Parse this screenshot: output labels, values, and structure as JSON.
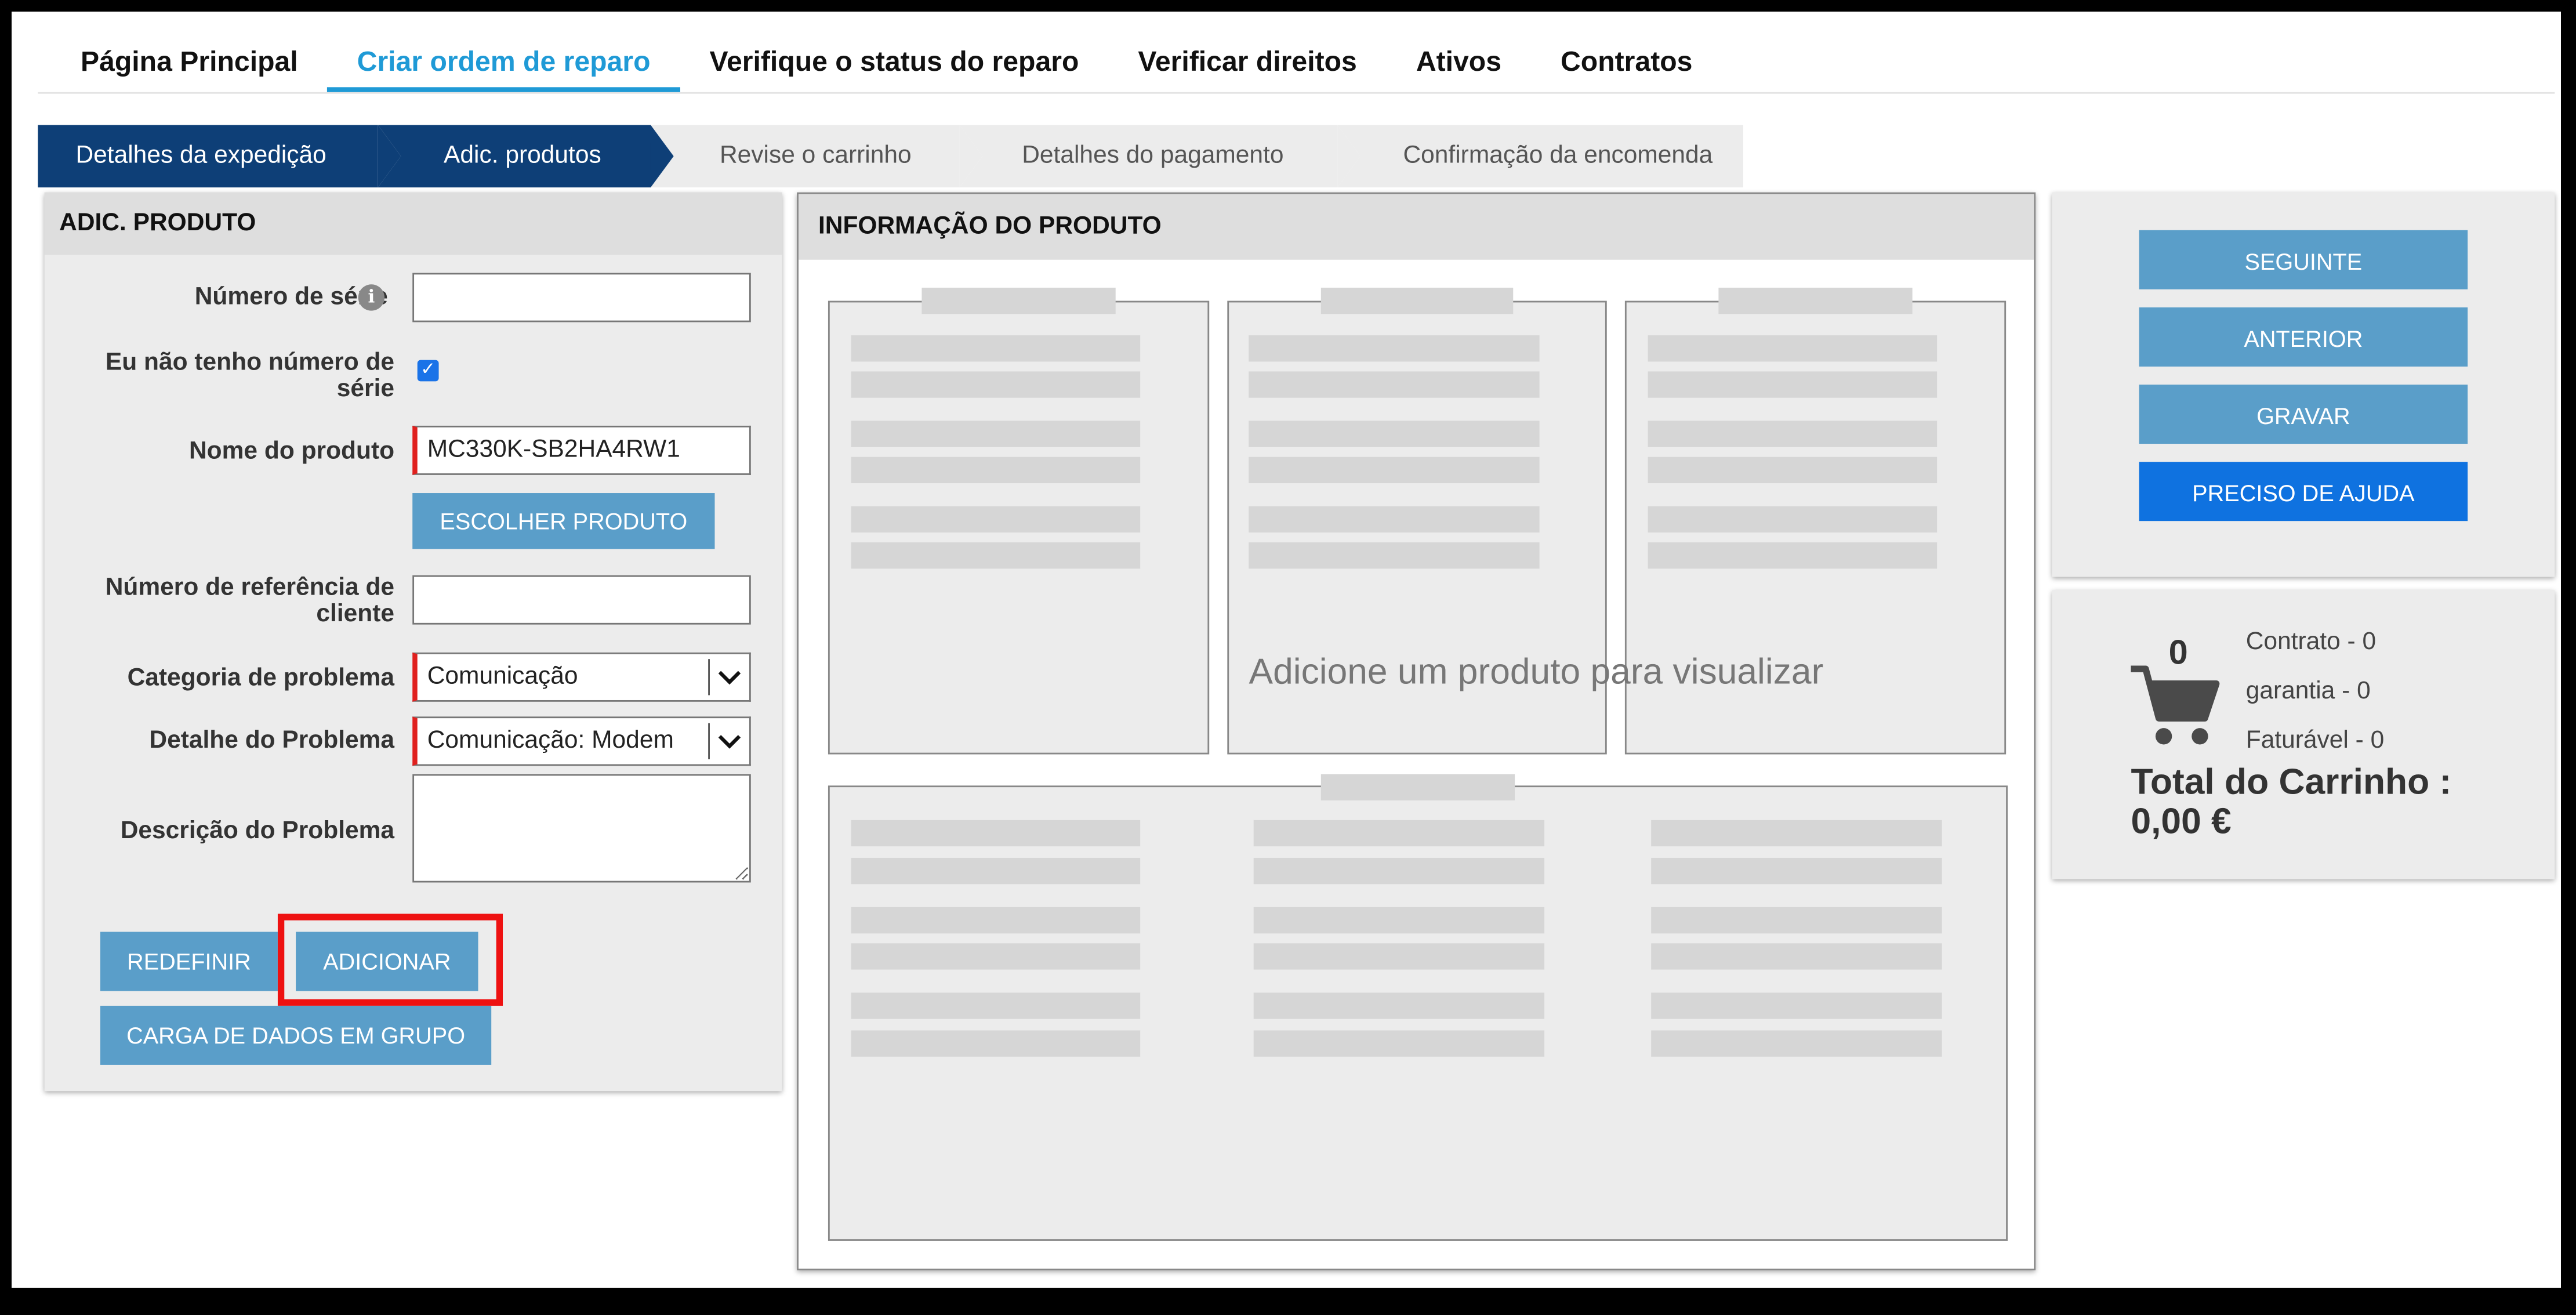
{
  "top_nav": [
    "Página Principal",
    "Criar ordem de reparo",
    "Verifique o status do reparo",
    "Verificar direitos",
    "Ativos",
    "Contratos"
  ],
  "steps": [
    "Detalhes da expedição",
    "Adic. produtos",
    "Revise o carrinho",
    "Detalhes do pagamento",
    "Confirmação da encomenda"
  ],
  "add_product": {
    "title": "ADIC. PRODUTO",
    "serial_label": "Número de série",
    "serial_value": "",
    "no_serial_label": "Eu não tenho número de série",
    "no_serial_checked": true,
    "product_name_label": "Nome do produto",
    "product_name_value": "MC330K-SB2HA4RW1",
    "choose_product_button": "ESCOLHER PRODUTO",
    "customer_ref_label": "Número de referência de cliente",
    "customer_ref_value": "",
    "problem_category_label": "Categoria de problema",
    "problem_category_value": "Comunicação",
    "problem_detail_label": "Detalhe do Problema",
    "problem_detail_value": "Comunicação: Modem",
    "problem_description_label": "Descrição do Problema",
    "problem_description_value": "",
    "reset_button": "REDEFINIR",
    "add_button": "ADICIONAR",
    "bulk_upload_button": "CARGA DE DADOS EM GRUPO"
  },
  "product_info": {
    "title": "INFORMAÇÃO DO PRODUTO",
    "placeholder": "Adicione um produto para visualizar"
  },
  "actions": {
    "next": "SEGUINTE",
    "previous": "ANTERIOR",
    "save": "GRAVAR",
    "help": "PRECISO DE AJUDA"
  },
  "cart": {
    "icon": "shopping-cart-icon",
    "count": "0",
    "contract": "Contrato - 0",
    "warranty": "garantia - 0",
    "billable": "Faturável - 0",
    "total_label": "Total do Carrinho :",
    "total_value": "0,00 €"
  },
  "colors": {
    "accent": "#1f9ad6",
    "step_done": "#0e3f77",
    "button": "#5a9ec9",
    "help_button": "#0f72e0",
    "highlight": "#ee1111"
  }
}
